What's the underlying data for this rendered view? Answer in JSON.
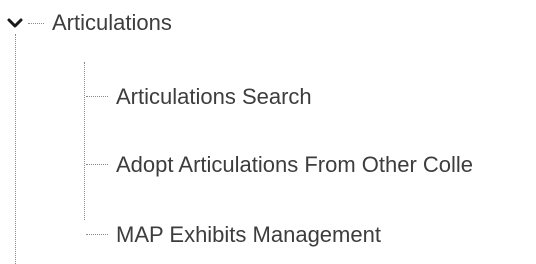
{
  "tree": {
    "root": {
      "label": "Articulations",
      "expanded": true,
      "toggle_icon": "chevron-down-icon"
    },
    "children": [
      {
        "label": "Articulations Search"
      },
      {
        "label": "Adopt Articulations From Other Colle"
      },
      {
        "label": "MAP Exhibits Management"
      }
    ]
  },
  "colors": {
    "text": "#3d3d3d",
    "guide_lines": "#8a8a8a",
    "toggle_icon": "#1a1a1a"
  }
}
